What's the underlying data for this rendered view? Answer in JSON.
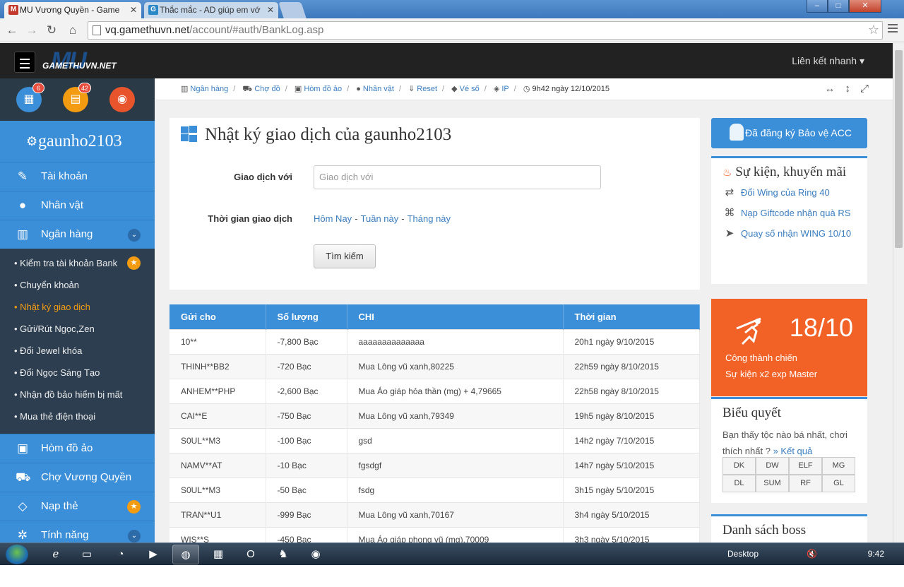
{
  "browser": {
    "tabs": [
      {
        "title": "MU Vương Quyền - Game",
        "active": true
      },
      {
        "title": "Thắc mắc - AD giúp em vớ",
        "active": false
      }
    ],
    "url_host": "vq.gamethuvn.net",
    "url_path": "/account/#auth/BankLog.asp",
    "window_controls": {
      "minimize": "–",
      "maximize": "□",
      "close": "✕"
    }
  },
  "topnav": {
    "logo_big": "MU",
    "logo_small": "GAMETHUVN.NET",
    "quick_links": "Liên kết nhanh ▾"
  },
  "sidebar": {
    "badges": {
      "calendar": "6",
      "card": "42"
    },
    "username": "gaunho2103",
    "items": [
      {
        "label": "Tài khoản",
        "icon": "edit-icon"
      },
      {
        "label": "Nhân vật",
        "icon": "user-icon"
      },
      {
        "label": "Ngân hàng",
        "icon": "bank-icon"
      }
    ],
    "bank_sub": [
      {
        "label": "• Kiểm tra tài khoản Bank",
        "star": true
      },
      {
        "label": "• Chuyển khoản"
      },
      {
        "label": "• Nhật ký giao dịch",
        "active": true
      },
      {
        "label": "• Gửi/Rút Ngọc,Zen"
      },
      {
        "label": "• Đổi Jewel khóa"
      },
      {
        "label": "• Đổi Ngọc Sáng Tạo"
      },
      {
        "label": "• Nhận đồ bảo hiểm bị mất"
      },
      {
        "label": "• Mua thẻ điện thoại"
      }
    ],
    "lower_items": [
      {
        "label": "Hòm đồ ảo",
        "icon": "briefcase-icon"
      },
      {
        "label": "Chợ Vương Quyền",
        "icon": "cart-icon"
      },
      {
        "label": "Nạp thẻ",
        "icon": "diamond-icon"
      },
      {
        "label": "Tính năng",
        "icon": "gears-icon"
      }
    ]
  },
  "breadcrumb": {
    "items": [
      "Ngân hàng",
      "Chợ đồ",
      "Hòm đồ ảo",
      "Nhân vật",
      "Reset",
      "Vé số",
      "IP"
    ],
    "time": "9h42 ngày 12/10/2015"
  },
  "main": {
    "title": "Nhật ký giao dịch của gaunho2103",
    "label_partner": "Giao dịch với",
    "input_placeholder": "Giao dịch với",
    "label_time": "Thời gian giao dịch",
    "time_links": [
      "Hôm Nay",
      "Tuần này",
      "Tháng này"
    ],
    "search_button": "Tìm kiếm"
  },
  "table": {
    "headers": [
      "Gửi cho",
      "Số lượng",
      "CHI",
      "Thời gian"
    ],
    "rows": [
      [
        "10**",
        "-7,800  Bạc",
        "aaaaaaaaaaaaaa",
        "20h1 ngày 9/10/2015"
      ],
      [
        "THINH**BB2",
        "-720  Bạc",
        "Mua Lông vũ xanh,80225",
        "22h59 ngày 8/10/2015"
      ],
      [
        "ANHEM**PHP",
        "-2,600  Bạc",
        "Mua Áo giáp hỏa thần (mg) + 4,79665",
        "22h58 ngày 8/10/2015"
      ],
      [
        "CAI**E",
        "-750  Bạc",
        "Mua Lông vũ xanh,79349",
        "19h5 ngày 8/10/2015"
      ],
      [
        "S0UL**M3",
        "-100  Bạc",
        "gsd",
        "14h2 ngày 7/10/2015"
      ],
      [
        "NAMV**AT",
        "-10  Bạc",
        "fgsdgf",
        "14h7 ngày 5/10/2015"
      ],
      [
        "S0UL**M3",
        "-50  Bạc",
        "fsdg",
        "3h15 ngày 5/10/2015"
      ],
      [
        "TRAN**U1",
        "-999  Bạc",
        "Mua Lông vũ xanh,70167",
        "3h4 ngày 5/10/2015"
      ],
      [
        "WIS**S",
        "-450  Bạc",
        "Mua Áo giáp phong vũ (mg),70009",
        "3h3 ngày 5/10/2015"
      ]
    ]
  },
  "right": {
    "protect_label": "Đã đăng ký Bảo vệ ACC",
    "events_title": "Sự kiện, khuyến mãi",
    "events": [
      {
        "icon": "exchange-icon",
        "label": "Đổi Wing của Ring 40"
      },
      {
        "icon": "gift-icon",
        "label": "Nạp Giftcode nhận quà RS"
      },
      {
        "icon": "arrow-icon",
        "label": "Quay số nhận WING 10/10"
      }
    ],
    "promo": {
      "date": "18/10",
      "line1": "Công thành chiến",
      "line2": "Sự kiện x2 exp Master"
    },
    "poll_title": "Biểu quyết",
    "poll_question": "Bạn thấy tộc nào bá nhất, chơi thích nhất ?",
    "poll_result": "» Kết quả",
    "poll_options": [
      "DK",
      "DW",
      "ELF",
      "MG",
      "DL",
      "SUM",
      "RF",
      "GL"
    ],
    "boss_title": "Danh sách boss"
  },
  "taskbar": {
    "desktop_label": "Desktop",
    "clock": "9:42 AM"
  }
}
